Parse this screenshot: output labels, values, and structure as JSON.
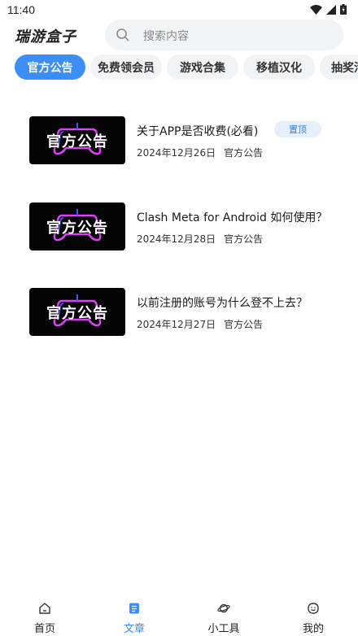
{
  "status_bar": {
    "time": "11:40",
    "icons": [
      "wifi-icon",
      "signal-icon",
      "battery-icon"
    ]
  },
  "header": {
    "app_title": "瑞游盒子",
    "search": {
      "placeholder": "搜索内容",
      "icon": "search-icon"
    }
  },
  "tabs": [
    {
      "label": "官方公告",
      "active": true
    },
    {
      "label": "免费领会员",
      "active": false
    },
    {
      "label": "游戏合集",
      "active": false
    },
    {
      "label": "移植汉化",
      "active": false
    },
    {
      "label": "抽奖活",
      "active": false
    }
  ],
  "articles": [
    {
      "thumbnail_text": "官方公告",
      "title": "关于APP是否收费(必看)",
      "date": "2024年12月26日",
      "category": "官方公告",
      "badge": "置顶"
    },
    {
      "thumbnail_text": "官方公告",
      "title": "Clash Meta for Android 如何使用？",
      "date": "2024年12月28日",
      "category": "官方公告"
    },
    {
      "thumbnail_text": "官方公告",
      "title": "以前注册的账号为什么登不上去？",
      "date": "2024年12月27日",
      "category": "官方公告"
    }
  ],
  "bottom_nav": [
    {
      "label": "首页",
      "icon": "home-icon",
      "active": false
    },
    {
      "label": "文章",
      "icon": "document-icon",
      "active": true
    },
    {
      "label": "小工具",
      "icon": "planet-icon",
      "active": false
    },
    {
      "label": "我的",
      "icon": "profile-icon",
      "active": false
    }
  ],
  "colors": {
    "accent": "#3a8ef6",
    "tab_bg": "#f2f3f5",
    "badge_bg": "#e6effc",
    "badge_text": "#3a7ee8",
    "thumb_glow_pink": "#e040fb",
    "thumb_glow_blue": "#3d5afe"
  }
}
